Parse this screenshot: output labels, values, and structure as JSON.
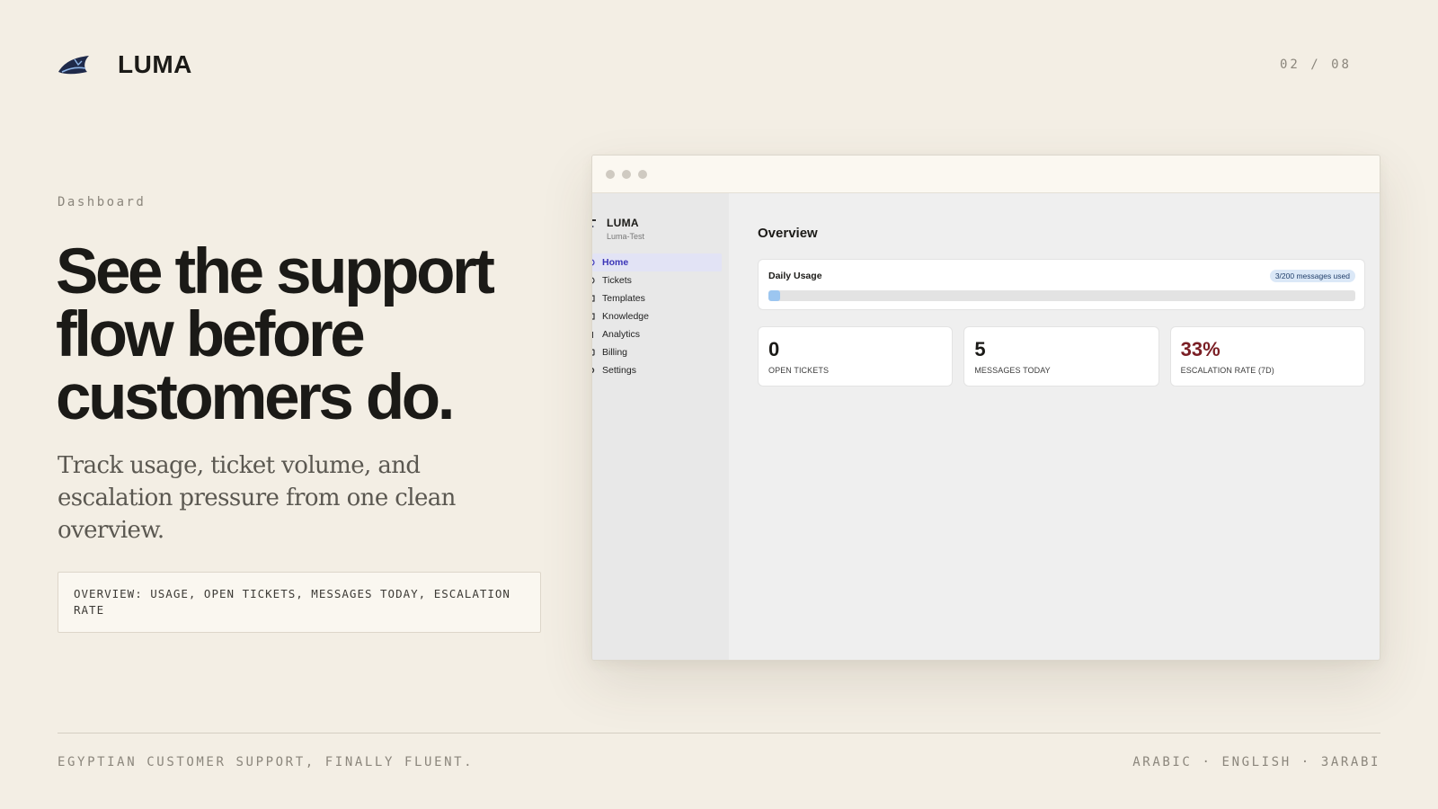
{
  "brand": {
    "name": "LUMA"
  },
  "page_counter": "02 / 08",
  "eyebrow": "Dashboard",
  "headline": "See the support flow before customers do.",
  "subhead": "Track usage, ticket volume, and escalation pressure from one clean overview.",
  "code_caption": "OVERVIEW: USAGE, OPEN TICKETS, MESSAGES TODAY, ESCALATION RATE",
  "app": {
    "sidebar": {
      "brand_name": "LUMA",
      "workspace": "Luma-Test",
      "items": [
        {
          "label": "Home",
          "active": true
        },
        {
          "label": "Tickets"
        },
        {
          "label": "Templates"
        },
        {
          "label": "Knowledge"
        },
        {
          "label": "Analytics"
        },
        {
          "label": "Billing"
        },
        {
          "label": "Settings"
        }
      ]
    },
    "main": {
      "title": "Overview",
      "usage": {
        "label": "Daily Usage",
        "badge": "3/200 messages used",
        "progress": 0.015
      },
      "stats": [
        {
          "value": "0",
          "label": "OPEN TICKETS"
        },
        {
          "value": "5",
          "label": "MESSAGES TODAY"
        },
        {
          "value": "33%",
          "label": "ESCALATION RATE (7D)",
          "alert": true
        }
      ]
    }
  },
  "footer": {
    "tagline": "EGYPTIAN CUSTOMER SUPPORT, FINALLY FLUENT.",
    "languages": "ARABIC · ENGLISH · 3ARABI"
  },
  "colors": {
    "background": "#f3eee4",
    "active_nav": "#3b35b8",
    "progress_fill": "#9cc6f0",
    "alert": "#7a1e24"
  }
}
